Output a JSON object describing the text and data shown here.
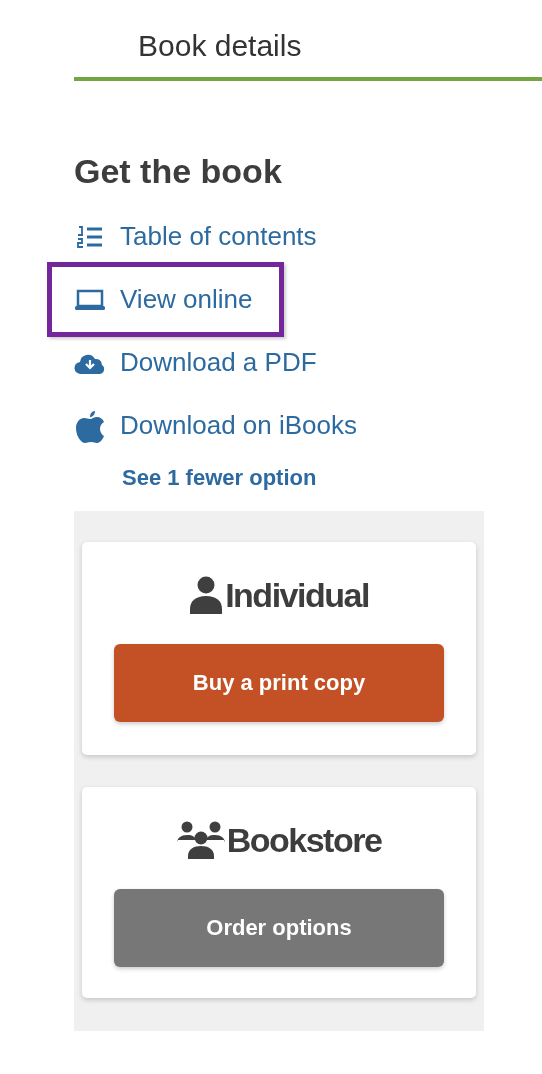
{
  "tab": {
    "label": "Book details",
    "selected": true
  },
  "heading": "Get the book",
  "links": [
    {
      "kind": "contents",
      "label": "Table of contents",
      "highlighted": false
    },
    {
      "kind": "online",
      "label": "View online",
      "highlighted": true
    },
    {
      "kind": "pdf",
      "label": "Download a PDF",
      "highlighted": false
    },
    {
      "kind": "ibooks",
      "label": "Download on iBooks",
      "highlighted": false
    }
  ],
  "toggle": "See 1 fewer option",
  "cards": [
    {
      "kind": "individual",
      "title": "Individual",
      "button": "Buy a print copy"
    },
    {
      "kind": "bookstore",
      "title": "Bookstore",
      "button": "Order options"
    }
  ]
}
